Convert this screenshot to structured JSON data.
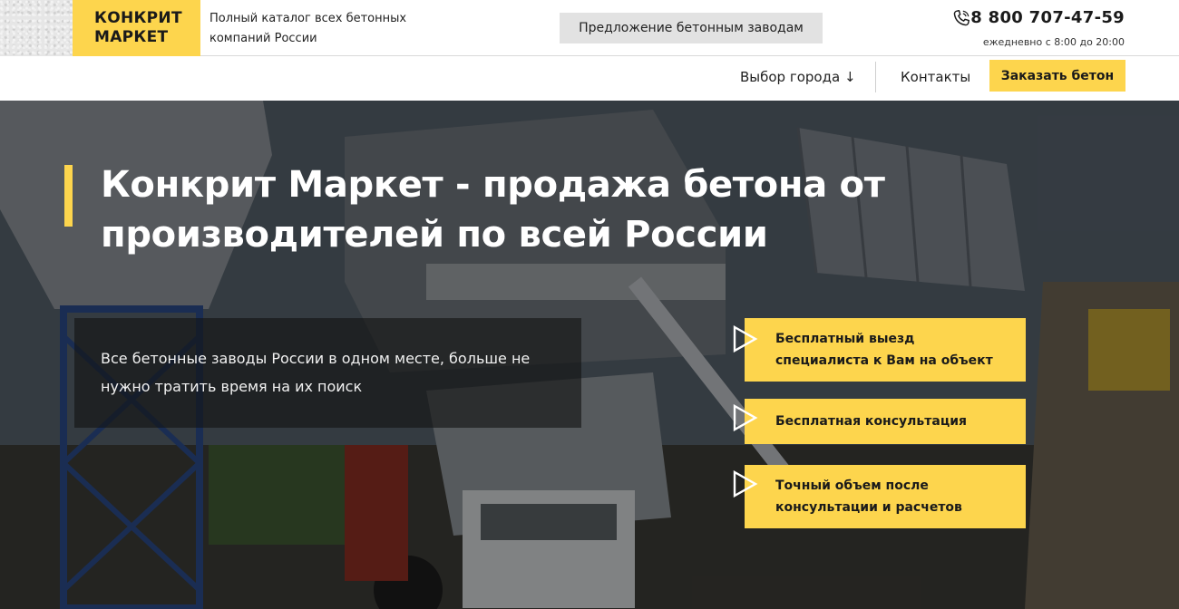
{
  "header": {
    "logo_line1": "КОНКРИТ",
    "logo_line2": "МАРКЕТ",
    "tagline": "Полный каталог всех бетонных компаний России",
    "offer_button": "Предложение бетонным заводам",
    "phone": "8 800 707-47-59",
    "hours": "ежедневно с 8:00 до 20:00",
    "phone_icon": "phone-icon"
  },
  "nav": {
    "city": "Выбор города ↓",
    "contacts": "Контакты",
    "order": "Заказать бетон"
  },
  "hero": {
    "title": "Конкрит Маркет - продажа бетона от производителей по всей России",
    "subtitle": "Все бетонные заводы России в одном месте, больше не нужно тратить время на их поиск",
    "features": [
      "Бесплатный выезд специалиста к Вам на объект",
      "Бесплатная консультация",
      "Точный объем после консультации и расчетов"
    ]
  },
  "colors": {
    "accent": "#fdd54d",
    "offer_button_bg": "#e2e2e2"
  }
}
